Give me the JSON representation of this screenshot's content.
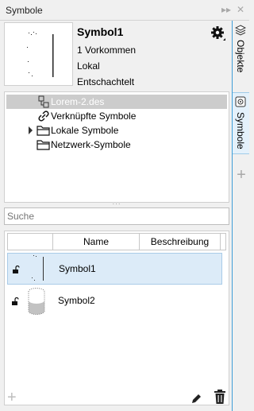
{
  "window": {
    "title": "Symbole"
  },
  "symbol_info": {
    "name": "Symbol1",
    "instances": "1 Vorkommen",
    "scope": "Lokal",
    "nesting": "Entschachtelt"
  },
  "tree": {
    "items": [
      {
        "label": "Lorem-2.des",
        "icon": "document-icon",
        "selected": true
      },
      {
        "label": "Verknüpfte Symbole",
        "icon": "link-icon"
      },
      {
        "label": "Lokale Symbole",
        "icon": "folder-icon",
        "expandable": true
      },
      {
        "label": "Netzwerk-Symbole",
        "icon": "folder-icon"
      }
    ]
  },
  "search": {
    "placeholder": "Suche"
  },
  "list": {
    "columns": [
      "Name",
      "Beschreibung"
    ],
    "rows": [
      {
        "name": "Symbol1",
        "selected": true
      },
      {
        "name": "Symbol2",
        "selected": false
      }
    ]
  },
  "side_tabs": [
    {
      "label": "Objekte",
      "icon": "layers-icon",
      "active": false
    },
    {
      "label": "Symbole",
      "icon": "symbol-icon",
      "active": true
    }
  ],
  "colors": {
    "selection": "#dcebf8",
    "accent": "#3f9ed8",
    "tree_selection": "#cccccc"
  }
}
